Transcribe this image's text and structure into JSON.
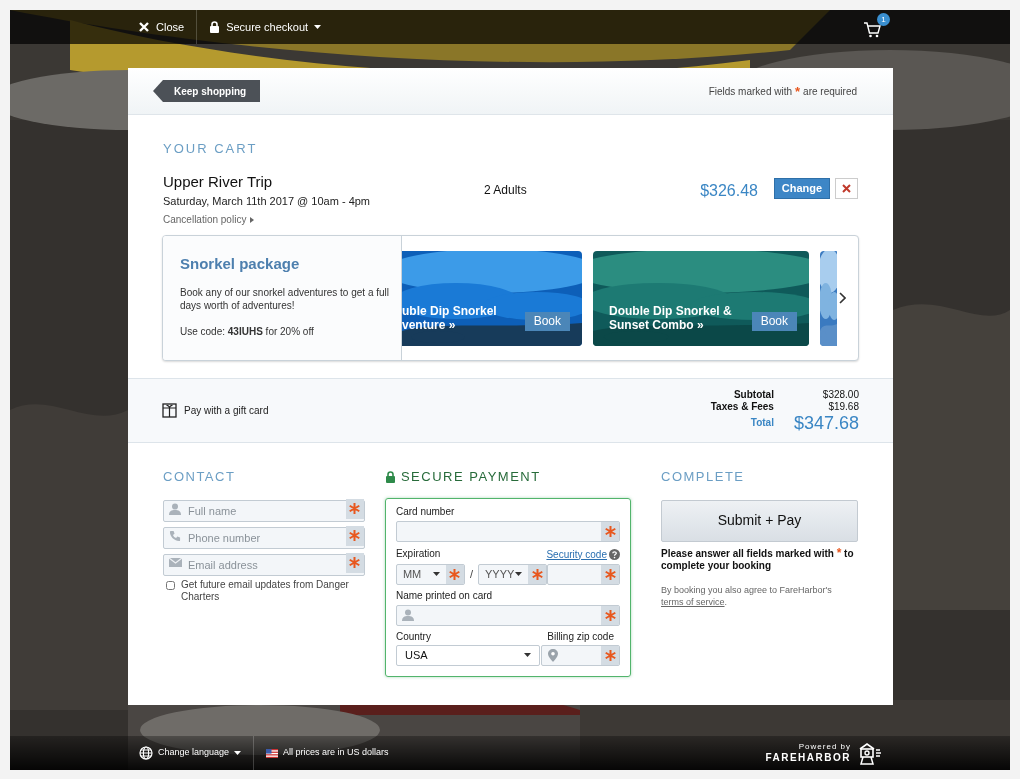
{
  "topbar": {
    "close": "Close",
    "checkout": "Secure checkout",
    "cart_count": "1"
  },
  "header": {
    "keep_shopping": "Keep shopping",
    "required_before": "Fields marked with",
    "required_mark": "*",
    "required_after": "are required"
  },
  "cart": {
    "heading": "YOUR CART",
    "item": {
      "title": "Upper River Trip",
      "date": "Saturday, March 11th 2017 @ 10am - 4pm",
      "policy": "Cancellation policy",
      "guests": "2 Adults",
      "price": "$326.48",
      "change": "Change"
    }
  },
  "promo": {
    "title": "Snorkel package",
    "text": "Book any of our snorkel adventures to get a full days worth of adventures!",
    "code": "Use code: **43IUHS** for 20% off",
    "tiles": [
      {
        "kind": "cut",
        "lines": [
          "uble Dip Snorkel",
          "venture »"
        ],
        "book": "Book"
      },
      {
        "kind": "full",
        "lines": [
          "Double Dip Snorkel &",
          "Sunset Combo »"
        ],
        "book": "Book"
      },
      {
        "kind": "sliver"
      }
    ]
  },
  "totals": {
    "gift_card": "Pay with a gift card",
    "rows": [
      {
        "label": "Subtotal",
        "value": "$328.00"
      },
      {
        "label": "Taxes & Fees",
        "value": "$19.68"
      }
    ],
    "total_label": "Total",
    "total_value": "$347.68"
  },
  "contact": {
    "heading": "CONTACT",
    "fields": [
      {
        "kind": "user",
        "placeholder": "Full name",
        "required": true
      },
      {
        "kind": "phone",
        "placeholder": "Phone number",
        "required": true
      },
      {
        "kind": "mail",
        "placeholder": "Email address",
        "required": true
      }
    ],
    "updates": {
      "label": "Get future email updates from Danger Charters",
      "checked": false
    }
  },
  "payment": {
    "heading": "SECURE PAYMENT",
    "card_number": "Card number",
    "expiration": "Expiration",
    "security_code": "Security code",
    "month": "MM",
    "slash": "/",
    "year": "YYYY",
    "name_label": "Name printed on card",
    "country_label": "Country",
    "country": "USA",
    "zip_label": "Billing zip code"
  },
  "complete": {
    "heading": "COMPLETE",
    "submit": "Submit + Pay",
    "warning_before": "Please answer all fields marked with",
    "warning_mark": "*",
    "warning_after": "to complete your booking",
    "terms_before": "By booking you also agree to FareHarbor's",
    "terms_link": "terms of service",
    "terms_after": "."
  },
  "footer": {
    "language": "Change language",
    "currency": "All prices are in US dollars",
    "powered": "Powered by",
    "brand": "FAREHARBOR"
  }
}
